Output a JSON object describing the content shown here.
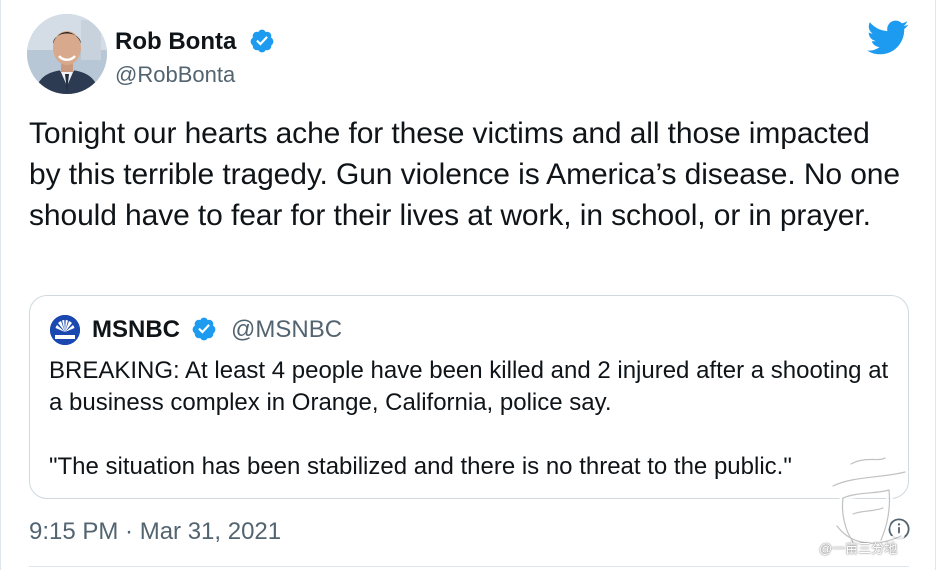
{
  "tweet": {
    "author": {
      "name": "Rob Bonta",
      "handle": "@RobBonta",
      "verified": true
    },
    "text": "Tonight our hearts ache for these victims and all those impacted by this terrible tragedy. Gun violence is America’s disease. No one should have to fear for their lives at work, in school, or in prayer.",
    "timestamp": "9:15 PM · Mar 31, 2021",
    "quoted": {
      "author": {
        "name": "MSNBC",
        "handle": "@MSNBC",
        "verified": true
      },
      "paragraphs": [
        "BREAKING: At least 4 people have been killed and 2 injured after a shooting at a business complex in Orange, California, police say.",
        "\"The situation has been stabilized and there is no threat to the public.\""
      ]
    }
  },
  "watermark": {
    "text": "@一亩三分地"
  },
  "icons": {
    "avatar": "profile-photo",
    "verified": "verified-badge-icon",
    "brand": "twitter-bird-icon",
    "quote_avatar": "msnbc-peacock-logo",
    "info": "info-icon"
  },
  "colors": {
    "accent": "#1d9bf0",
    "secondary_text": "#536471",
    "primary_text": "#0f1419",
    "border": "#cfd9de"
  }
}
